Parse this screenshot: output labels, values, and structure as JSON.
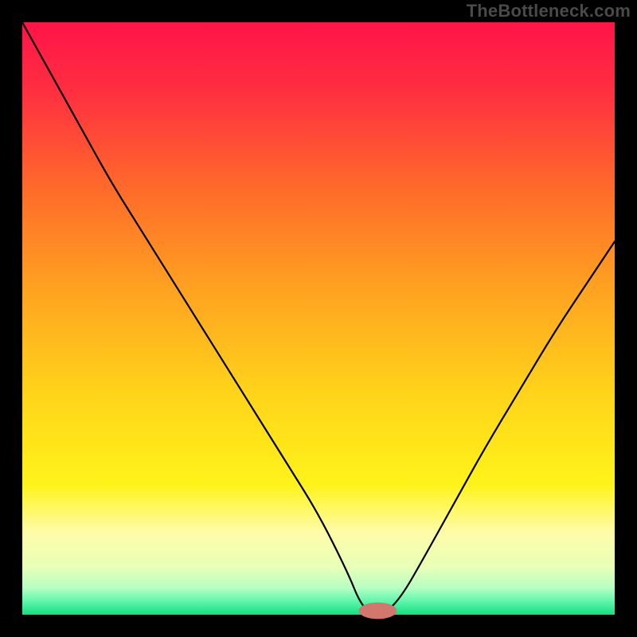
{
  "watermark": "TheBottleneck.com",
  "chart_data": {
    "type": "line",
    "title": "",
    "xlabel": "",
    "ylabel": "",
    "xlim": [
      0,
      100
    ],
    "ylim": [
      0,
      100
    ],
    "background": {
      "type": "vertical-gradient",
      "stops": [
        {
          "pos": 0.0,
          "color": "#ff1448"
        },
        {
          "pos": 0.12,
          "color": "#ff3040"
        },
        {
          "pos": 0.28,
          "color": "#ff6a2a"
        },
        {
          "pos": 0.45,
          "color": "#ffa220"
        },
        {
          "pos": 0.62,
          "color": "#ffd21a"
        },
        {
          "pos": 0.78,
          "color": "#fff31a"
        },
        {
          "pos": 0.86,
          "color": "#fffca8"
        },
        {
          "pos": 0.92,
          "color": "#e8ffb8"
        },
        {
          "pos": 0.955,
          "color": "#b5ffc3"
        },
        {
          "pos": 0.975,
          "color": "#68f7b0"
        },
        {
          "pos": 1.0,
          "color": "#12e07e"
        }
      ]
    },
    "series": [
      {
        "name": "bottleneck-curve",
        "color": "#000000",
        "width": 2.2,
        "x": [
          0,
          5,
          10,
          15,
          20,
          25,
          30,
          35,
          40,
          45,
          50,
          55,
          57,
          59,
          61,
          64,
          68,
          73,
          78,
          84,
          90,
          96,
          100
        ],
        "values": [
          100,
          91,
          82,
          73,
          65,
          57,
          49,
          41,
          33,
          25,
          17,
          7,
          2,
          0,
          0,
          3,
          10,
          19,
          28,
          38,
          48,
          57,
          63
        ]
      }
    ],
    "marker": {
      "name": "optimal-point",
      "shape": "pill",
      "color": "#d1776e",
      "cx": 60,
      "cy": 0,
      "rx": 3.2,
      "ry": 1.4
    }
  }
}
